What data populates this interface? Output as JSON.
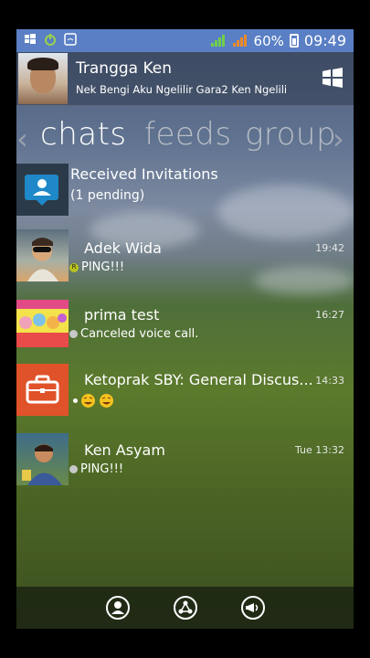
{
  "status_bar": {
    "battery": "60%",
    "time": "09:49"
  },
  "profile": {
    "name": "Trangga Ken",
    "status": "Nek Bengi Aku Ngelilir Gara2 Ken Ngelilir..."
  },
  "tabs": [
    "chats",
    "feeds",
    "group"
  ],
  "invitations": {
    "title": "Received Invitations",
    "pending": "(1 pending)"
  },
  "chats": [
    {
      "name": "Adek Wida",
      "preview": "PING!!!",
      "time": "19:42",
      "badge": "R"
    },
    {
      "name": "prima test",
      "preview": "Canceled voice call.",
      "time": "16:27"
    },
    {
      "name": "Ketoprak SBY: General Discus...",
      "preview": "",
      "time": "14:33"
    },
    {
      "name": "Ken Asyam",
      "preview": "PING!!!",
      "time": "Tue 13:32"
    }
  ],
  "colors": {
    "status_bar": "#5a7fc4",
    "group_icon_bg": "#e0522a",
    "invite_icon_bg": "#1e88c8"
  }
}
